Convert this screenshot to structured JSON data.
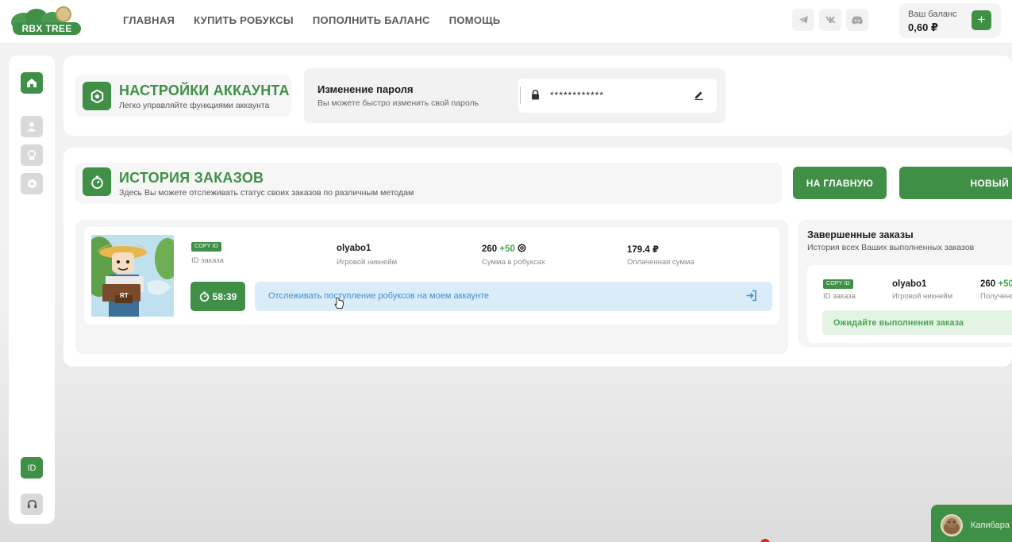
{
  "header": {
    "logo_text": "RBX TREE",
    "nav": [
      "ГЛАВНАЯ",
      "КУПИТЬ РОБУКСЫ",
      "ПОПОЛНИТЬ БАЛАНС",
      "ПОМОЩЬ"
    ],
    "social_icons": [
      "telegram-icon",
      "vk-icon",
      "discord-icon"
    ],
    "balance_label": "Ваш баланс",
    "balance_value": "0,60 ₽",
    "add_label": "+"
  },
  "sidebar": {
    "items": [
      "home-icon",
      "user-icon",
      "medal-icon",
      "settings-icon"
    ],
    "id_label": "ID",
    "support_icon": "headset-icon"
  },
  "settings": {
    "title": "НАСТРОЙКИ АККАУНТА",
    "subtitle": "Легко управляйте функциями аккаунта",
    "password_title": "Изменение пароля",
    "password_subtitle": "Вы можете быстро изменить свой пароль",
    "password_mask": "************"
  },
  "orders": {
    "title": "ИСТОРИЯ ЗАКАЗОВ",
    "subtitle": "Здесь Вы можете отслеживать статус своих заказов по различным методам",
    "btn_home": "НА ГЛАВНУЮ",
    "btn_new": "НОВЫЙ",
    "order": {
      "copy_label": "COPY ID",
      "id_label": "ID заказа",
      "nickname": "olyabo1",
      "nickname_label": "Игровой никнейм",
      "robux": "260",
      "robux_bonus": "+50",
      "robux_label": "Сумма в робуксах",
      "paid": "179.4 ₽",
      "paid_label": "Оплаченная сумма",
      "timer": "58:39",
      "track_text": "Отслеживать поступление робуксов на моем аккаунте",
      "img_badge": "RT"
    }
  },
  "completed": {
    "title": "Завершенные заказы",
    "subtitle": "История всех Ваших выполненных заказов",
    "copy_label": "COPY ID",
    "id_label": "ID заказа",
    "nickname": "olyabo1",
    "nickname_label": "Игровой никнейм",
    "robux": "260",
    "robux_bonus": "+50",
    "robux_label": "Получено",
    "wait_text": "Ожидайте выполнения заказа"
  },
  "chat": {
    "name": "Капибара"
  },
  "colors": {
    "accent": "#3f8f47",
    "track_bg": "#d9ecf8",
    "track_text": "#3d8fd0",
    "wait_bg": "#e4f4e4"
  }
}
